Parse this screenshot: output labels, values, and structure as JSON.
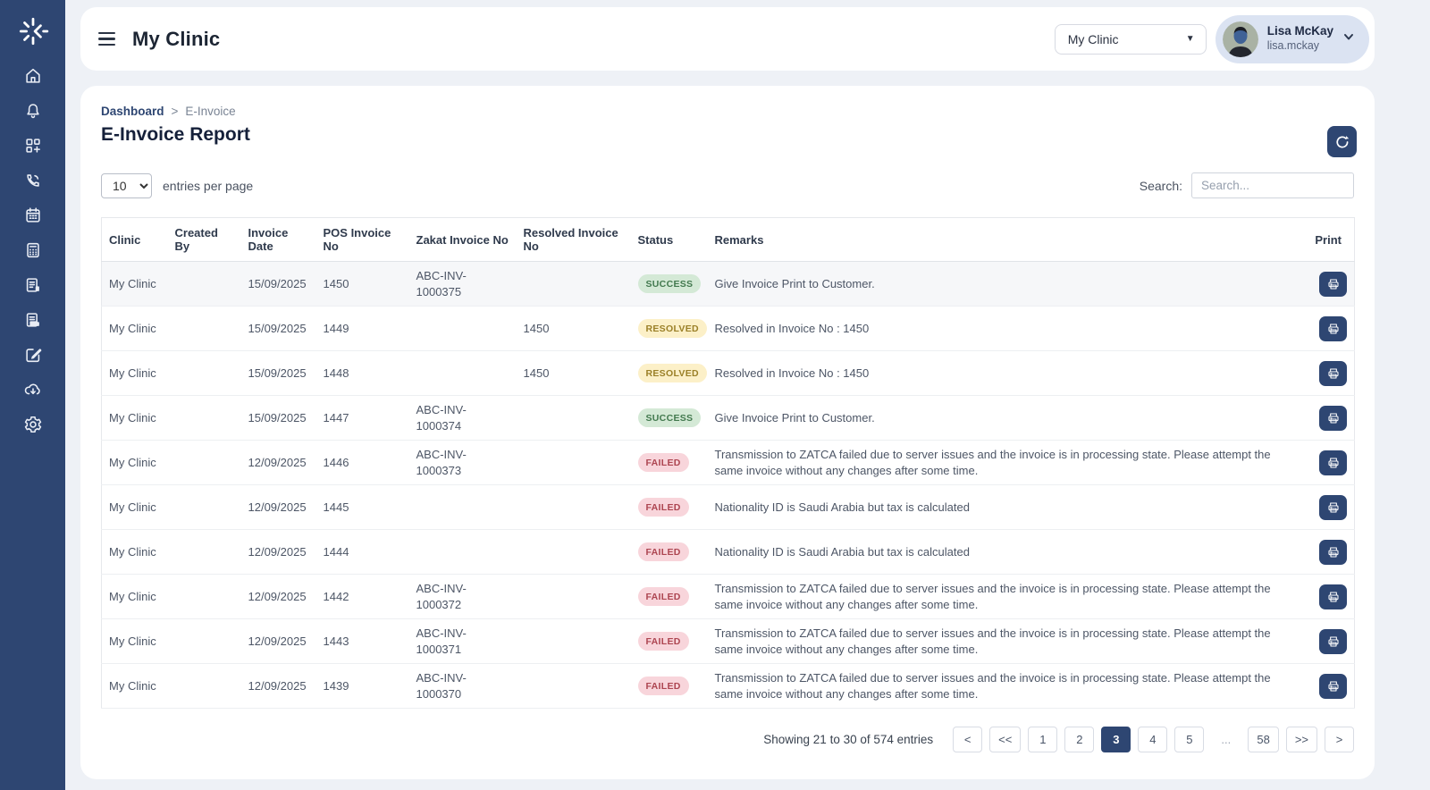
{
  "colors": {
    "accent_navy": "#2e4672",
    "page_background": "#eef1f6",
    "user_chip_background": "#dbe3f2",
    "status_success": {
      "bg": "#d4e9d6",
      "text": "#42794e"
    },
    "status_resolved": {
      "bg": "#fcf0c8",
      "text": "#9b8028"
    },
    "status_failed": {
      "bg": "#f8d5db",
      "text": "#ad4551"
    }
  },
  "sidebar": {
    "icons": [
      "logo",
      "home",
      "notifications",
      "apps-qr",
      "phone",
      "calendar",
      "calculator",
      "report",
      "invoices",
      "edit",
      "cloud-download",
      "settings"
    ]
  },
  "header": {
    "brand": "My Clinic",
    "clinic_select": {
      "value": "My Clinic"
    },
    "user": {
      "name": "Lisa McKay",
      "username": "lisa.mckay"
    }
  },
  "breadcrumb": {
    "items": [
      {
        "label": "Dashboard"
      },
      {
        "label": "E-Invoice"
      }
    ],
    "separator": ">"
  },
  "page": {
    "title": "E-Invoice Report"
  },
  "controls": {
    "entries_select": {
      "value": "10",
      "options": [
        "10"
      ]
    },
    "entries_label": "entries per page",
    "search_label": "Search:",
    "search_placeholder": "Search...",
    "search_value": ""
  },
  "table": {
    "columns": [
      "Clinic",
      "Created By",
      "Invoice Date",
      "POS Invoice No",
      "Zakat Invoice No",
      "Resolved Invoice No",
      "Status",
      "Remarks",
      "Print"
    ],
    "highlighted_row_index": 0,
    "rows": [
      {
        "clinic": "My Clinic",
        "created_by": "",
        "invoice_date": "15/09/2025",
        "pos_invoice_no": "1450",
        "zakat_invoice_no": "ABC-INV-1000375",
        "resolved_invoice_no": "",
        "status": "SUCCESS",
        "remarks": "Give Invoice Print to Customer."
      },
      {
        "clinic": "My Clinic",
        "created_by": "",
        "invoice_date": "15/09/2025",
        "pos_invoice_no": "1449",
        "zakat_invoice_no": "",
        "resolved_invoice_no": "1450",
        "status": "RESOLVED",
        "remarks": "Resolved in Invoice No : 1450"
      },
      {
        "clinic": "My Clinic",
        "created_by": "",
        "invoice_date": "15/09/2025",
        "pos_invoice_no": "1448",
        "zakat_invoice_no": "",
        "resolved_invoice_no": "1450",
        "status": "RESOLVED",
        "remarks": "Resolved in Invoice No : 1450"
      },
      {
        "clinic": "My Clinic",
        "created_by": "",
        "invoice_date": "15/09/2025",
        "pos_invoice_no": "1447",
        "zakat_invoice_no": "ABC-INV-1000374",
        "resolved_invoice_no": "",
        "status": "SUCCESS",
        "remarks": "Give Invoice Print to Customer."
      },
      {
        "clinic": "My Clinic",
        "created_by": "",
        "invoice_date": "12/09/2025",
        "pos_invoice_no": "1446",
        "zakat_invoice_no": "ABC-INV-1000373",
        "resolved_invoice_no": "",
        "status": "FAILED",
        "remarks": "Transmission to ZATCA failed due to server issues and the invoice is in processing state. Please attempt the same invoice without any changes after some time."
      },
      {
        "clinic": "My Clinic",
        "created_by": "",
        "invoice_date": "12/09/2025",
        "pos_invoice_no": "1445",
        "zakat_invoice_no": "",
        "resolved_invoice_no": "",
        "status": "FAILED",
        "remarks": "Nationality ID is Saudi Arabia but tax is calculated"
      },
      {
        "clinic": "My Clinic",
        "created_by": "",
        "invoice_date": "12/09/2025",
        "pos_invoice_no": "1444",
        "zakat_invoice_no": "",
        "resolved_invoice_no": "",
        "status": "FAILED",
        "remarks": "Nationality ID is Saudi Arabia but tax is calculated"
      },
      {
        "clinic": "My Clinic",
        "created_by": "",
        "invoice_date": "12/09/2025",
        "pos_invoice_no": "1442",
        "zakat_invoice_no": "ABC-INV-1000372",
        "resolved_invoice_no": "",
        "status": "FAILED",
        "remarks": "Transmission to ZATCA failed due to server issues and the invoice is in processing state. Please attempt the same invoice without any changes after some time."
      },
      {
        "clinic": "My Clinic",
        "created_by": "",
        "invoice_date": "12/09/2025",
        "pos_invoice_no": "1443",
        "zakat_invoice_no": "ABC-INV-1000371",
        "resolved_invoice_no": "",
        "status": "FAILED",
        "remarks": "Transmission to ZATCA failed due to server issues and the invoice is in processing state. Please attempt the same invoice without any changes after some time."
      },
      {
        "clinic": "My Clinic",
        "created_by": "",
        "invoice_date": "12/09/2025",
        "pos_invoice_no": "1439",
        "zakat_invoice_no": "ABC-INV-1000370",
        "resolved_invoice_no": "",
        "status": "FAILED",
        "remarks": "Transmission to ZATCA failed due to server issues and the invoice is in processing state. Please attempt the same invoice without any changes after some time."
      }
    ]
  },
  "pagination": {
    "summary": "Showing 21 to 30 of 574 entries",
    "items": [
      "<",
      "<<",
      "1",
      "2",
      "3",
      "4",
      "5",
      "...",
      "58",
      ">>",
      ">"
    ],
    "active": "3"
  }
}
